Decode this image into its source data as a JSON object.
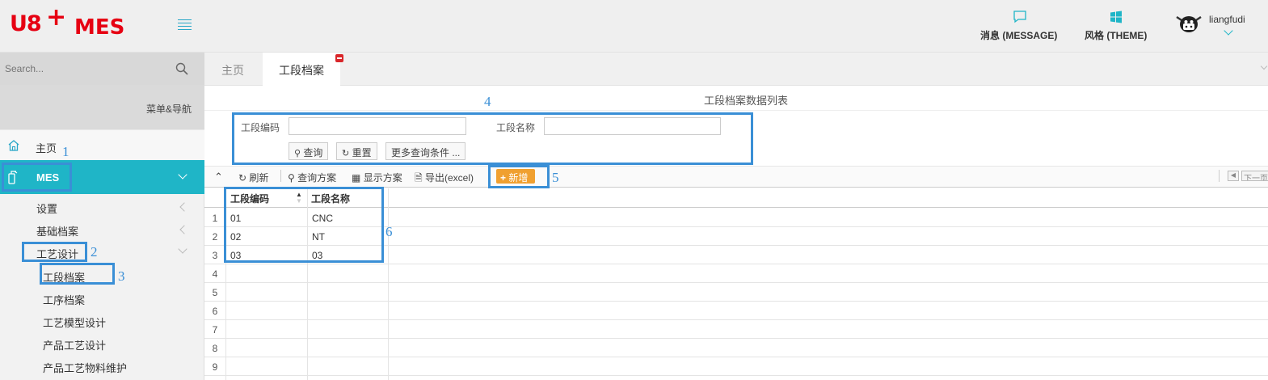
{
  "app": {
    "logo_text": "U8",
    "logo_plus": "+",
    "logo_mes": "MES"
  },
  "sidebar": {
    "search_placeholder": "Search...",
    "menu_nav_label": "菜单&导航",
    "home_label": "主页",
    "mes_label": "MES",
    "items": [
      {
        "label": "设置"
      },
      {
        "label": "基础档案"
      },
      {
        "label": "工艺设计"
      }
    ],
    "subitems": [
      {
        "label": "工段档案"
      },
      {
        "label": "工序档案"
      },
      {
        "label": "工艺模型设计"
      },
      {
        "label": "产品工艺设计"
      },
      {
        "label": "产品工艺物料维护"
      }
    ]
  },
  "header": {
    "message_label": "消息 (MESSAGE)",
    "theme_label": "风格 (THEME)",
    "username": "liangfudi"
  },
  "tabs": [
    {
      "label": "主页"
    },
    {
      "label": "工段档案"
    }
  ],
  "page": {
    "title": "工段档案数据列表",
    "filter": {
      "code_label": "工段编码",
      "code_value": "",
      "name_label": "工段名称",
      "name_value": "",
      "query_button": "查询",
      "reset_button": "重置",
      "more_button": "更多查询条件 ..."
    },
    "toolbar": {
      "refresh": "刷新",
      "query_scheme": "查询方案",
      "display_scheme": "显示方案",
      "export": "导出(excel)",
      "add": "新增",
      "next_page": "下一页"
    },
    "table": {
      "columns": [
        "工段编码",
        "工段名称"
      ],
      "rows": [
        {
          "num": "1",
          "code": "01",
          "name": "CNC"
        },
        {
          "num": "2",
          "code": "02",
          "name": "NT"
        },
        {
          "num": "3",
          "code": "03",
          "name": "03"
        },
        {
          "num": "4",
          "code": "",
          "name": ""
        },
        {
          "num": "5",
          "code": "",
          "name": ""
        },
        {
          "num": "6",
          "code": "",
          "name": ""
        },
        {
          "num": "7",
          "code": "",
          "name": ""
        },
        {
          "num": "8",
          "code": "",
          "name": ""
        },
        {
          "num": "9",
          "code": "",
          "name": ""
        }
      ]
    }
  },
  "annotations": [
    "1",
    "2",
    "3",
    "4",
    "5",
    "6"
  ],
  "colors": {
    "brand_red": "#e60012",
    "accent_teal": "#1fb5c7",
    "annotation_blue": "#3a8fd6",
    "add_orange": "#f0a030"
  }
}
